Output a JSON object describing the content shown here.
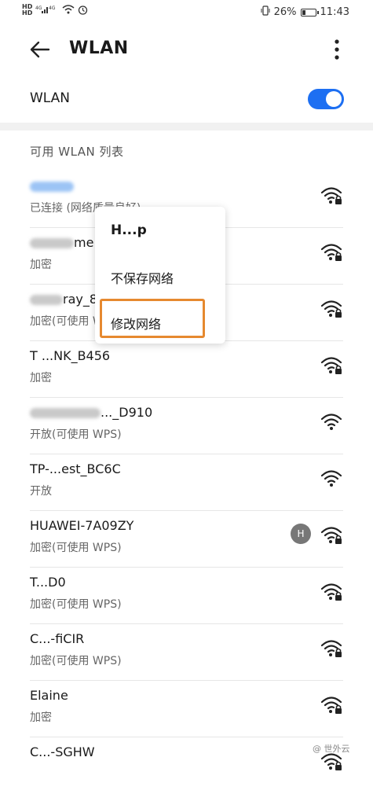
{
  "status_bar": {
    "hd_top": "HD",
    "hd_bottom": "HD",
    "net1": "4G",
    "net2": "4G",
    "battery_percent_text": "26%",
    "battery_level": 0.26,
    "time": "11:43"
  },
  "header": {
    "title": "WLAN"
  },
  "wlan_toggle": {
    "label": "WLAN",
    "on": true,
    "accent_color": "#1d6ff2"
  },
  "list_title": "可用 WLAN 列表",
  "networks": [
    {
      "ssid_visible": "",
      "status": "已连接 (网络质量良好)",
      "locked": true
    },
    {
      "ssid_visible": "me",
      "status": "加密",
      "locked": true
    },
    {
      "ssid_visible": "ray_8",
      "status": "加密(可使用 WPS)",
      "locked": true
    },
    {
      "ssid_visible": "T ...NK_B456",
      "status": "加密",
      "locked": true
    },
    {
      "ssid_visible": "..._D910",
      "status": "开放(可使用 WPS)",
      "locked": false
    },
    {
      "ssid_visible": "TP-...est_BC6C",
      "status": "开放",
      "locked": false
    },
    {
      "ssid_visible": "HUAWEI-7A09ZY",
      "status": "加密(可使用 WPS)",
      "locked": true,
      "badge": "H"
    },
    {
      "ssid_visible": "T...D0",
      "status": "加密(可使用 WPS)",
      "locked": true
    },
    {
      "ssid_visible": "C...-fiCIR",
      "status": "加密(可使用 WPS)",
      "locked": true
    },
    {
      "ssid_visible": "Elaine",
      "status": "加密",
      "locked": true
    },
    {
      "ssid_visible": "C...-SGHW",
      "status": "",
      "locked": true
    }
  ],
  "popup_menu": {
    "title": "H...p",
    "items": [
      "不保存网络",
      "修改网络"
    ],
    "highlight_color": "#e6892f"
  },
  "watermark": "@ 世外云"
}
